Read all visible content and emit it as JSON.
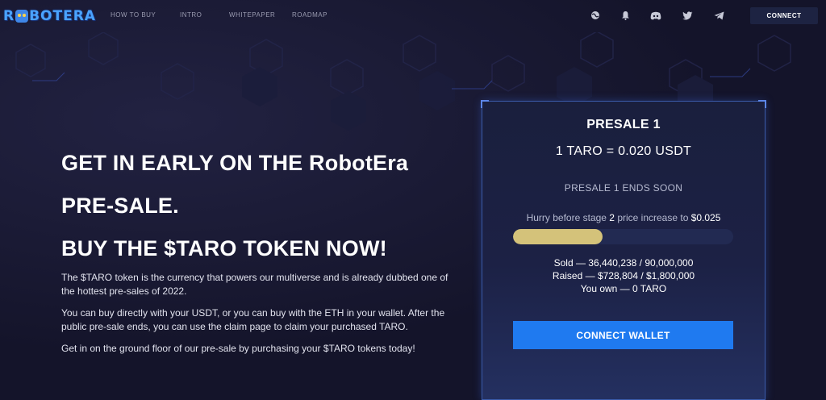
{
  "brand": {
    "logo_text_before": "R",
    "logo_text_after": "BOTERA"
  },
  "nav": {
    "items": [
      "HOW TO BUY",
      "INTRO",
      "WHITEPAPER",
      "ROADMAP"
    ]
  },
  "header_icons": [
    "globe-icon",
    "bell-icon",
    "discord-icon",
    "twitter-icon",
    "telegram-icon"
  ],
  "header": {
    "connect_label": "CONNECT"
  },
  "hero": {
    "title_lines": [
      "GET IN EARLY ON THE RobotEra",
      "PRE-SALE.",
      "BUY THE $TARO TOKEN NOW!"
    ],
    "paragraphs": [
      "The $TARO token is the currency that powers our multiverse and is already dubbed one of the hottest pre-sales of 2022.",
      "You can buy directly with your USDT, or you can buy with the ETH in your wallet. After the public pre-sale ends, you can use the claim page to claim your purchased TARO.",
      "Get in on the ground floor of our pre-sale by purchasing your $TARO tokens today!"
    ]
  },
  "presale": {
    "title": "PRESALE 1",
    "rate": "1 TARO = 0.020 USDT",
    "ends": "PRESALE 1 ENDS SOON",
    "hurry_prefix": "Hurry before stage ",
    "hurry_stage": "2",
    "hurry_middle": " price increase to ",
    "hurry_price": "$0.025",
    "progress_fraction": 0.405,
    "sold": "Sold — 36,440,238 / 90,000,000",
    "raised": "Raised — $728,804 / $1,800,000",
    "owned": "You own — 0 TARO",
    "button_label": "CONNECT WALLET"
  },
  "colors": {
    "background": "#14142a",
    "accent_blue": "#1f7af0",
    "progress_gold": "#d4c27a"
  }
}
